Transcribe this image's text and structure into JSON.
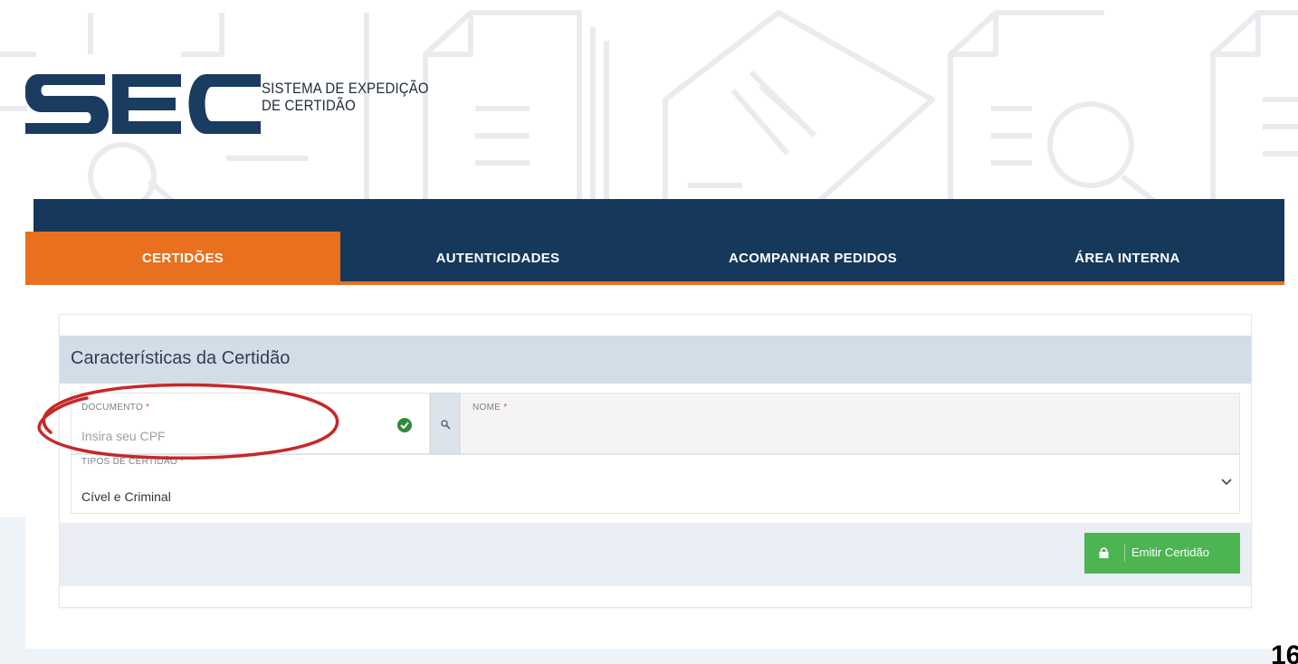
{
  "logo": {
    "mark": "SEC",
    "line1": "SISTEMA DE EXPEDIÇÃO",
    "line2": "DE CERTIDÃO"
  },
  "tabs": [
    {
      "label": "CERTIDÕES",
      "active": true
    },
    {
      "label": "AUTENTICIDADES",
      "active": false
    },
    {
      "label": "ACOMPANHAR PEDIDOS",
      "active": false
    },
    {
      "label": "ÁREA INTERNA",
      "active": false
    }
  ],
  "card": {
    "title": "Características da Certidão",
    "documento": {
      "label": "DOCUMENTO",
      "required_mark": "*",
      "placeholder": "Insira seu CPF",
      "value": ""
    },
    "nome": {
      "label": "NOME",
      "required_mark": "*"
    },
    "tipos": {
      "label": "TIPOS DE CERTIDÃO",
      "required_mark": "*",
      "selected": "Cível e Criminal"
    },
    "emit_button": "Emitir Certidão"
  },
  "icons": {
    "check": "check-circle-icon",
    "search": "search-icon",
    "chevron": "chevron-down-icon",
    "lock": "lock-icon"
  },
  "colors": {
    "navy": "#16385a",
    "orange": "#e8701f",
    "green": "#4cb552",
    "annotation_red": "#c62828"
  },
  "page_number": "16"
}
